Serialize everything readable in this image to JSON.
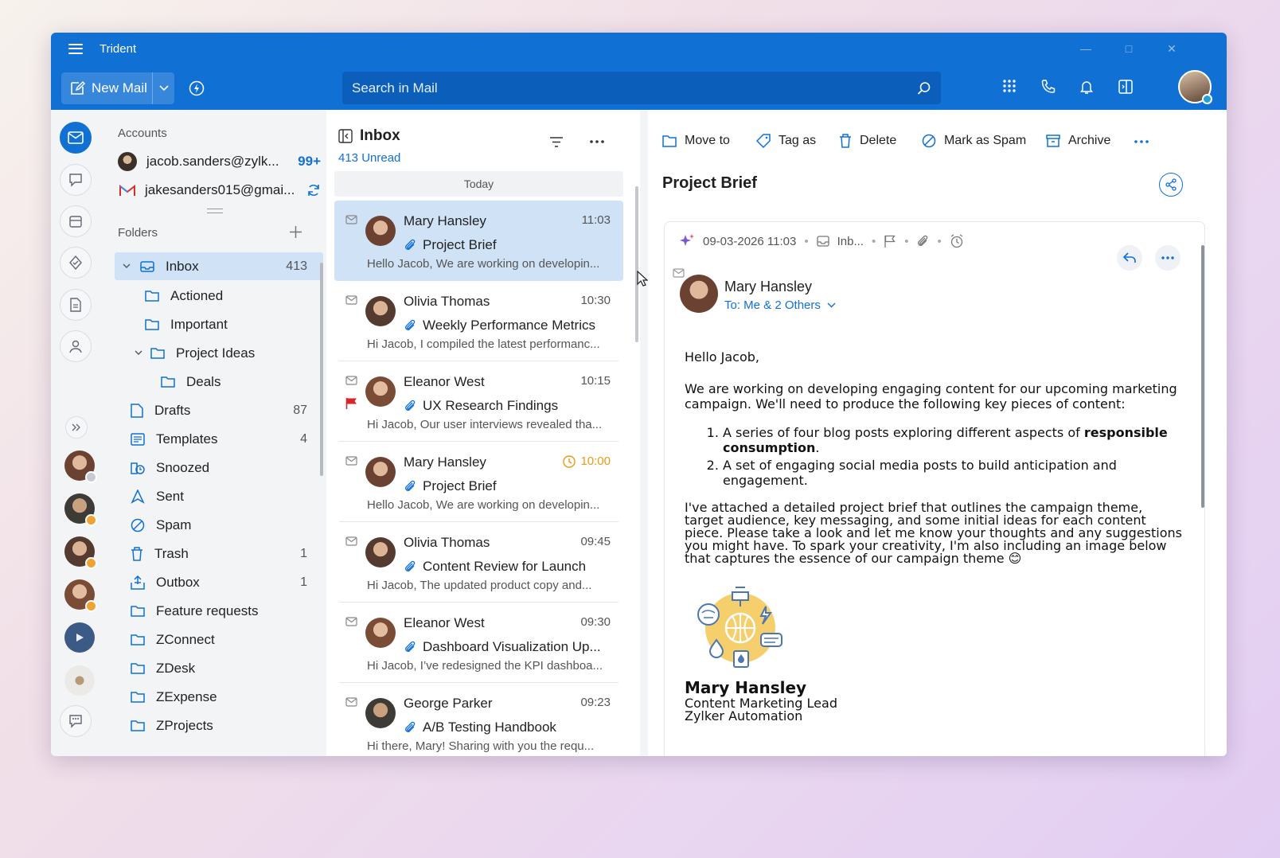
{
  "app": {
    "title": "Trident"
  },
  "toolbar": {
    "new_mail": "New Mail",
    "search_placeholder": "Search in Mail"
  },
  "accounts": {
    "label": "Accounts",
    "items": [
      {
        "email": "jacob.sanders@zylk...",
        "badge": "99+"
      },
      {
        "email": "jakesanders015@gmai..."
      }
    ]
  },
  "folders": {
    "label": "Folders",
    "items": [
      {
        "name": "Inbox",
        "count": "413"
      },
      {
        "name": "Actioned",
        "count": ""
      },
      {
        "name": "Important",
        "count": ""
      },
      {
        "name": "Project Ideas",
        "count": ""
      },
      {
        "name": "Deals",
        "count": ""
      },
      {
        "name": "Drafts",
        "count": "87"
      },
      {
        "name": "Templates",
        "count": "4"
      },
      {
        "name": "Snoozed",
        "count": ""
      },
      {
        "name": "Sent",
        "count": ""
      },
      {
        "name": "Spam",
        "count": ""
      },
      {
        "name": "Trash",
        "count": "1"
      },
      {
        "name": "Outbox",
        "count": "1"
      },
      {
        "name": "Feature requests",
        "count": ""
      },
      {
        "name": "ZConnect",
        "count": ""
      },
      {
        "name": "ZDesk",
        "count": ""
      },
      {
        "name": "ZExpense",
        "count": ""
      },
      {
        "name": "ZProjects",
        "count": ""
      }
    ]
  },
  "list": {
    "title": "Inbox",
    "unread": "413 Unread",
    "group": "Today",
    "mails": [
      {
        "from": "Mary Hansley",
        "time": "11:03",
        "subject": "Project Brief",
        "preview": "Hello Jacob, We are working on developin..."
      },
      {
        "from": "Olivia Thomas",
        "time": "10:30",
        "subject": "Weekly Performance Metrics",
        "preview": "Hi Jacob, I compiled the latest performanc..."
      },
      {
        "from": "Eleanor West",
        "time": "10:15",
        "subject": "UX Research Findings",
        "preview": "Hi Jacob, Our user interviews revealed tha..."
      },
      {
        "from": "Mary Hansley",
        "time": "10:00",
        "subject": "Project Brief",
        "preview": "Hello Jacob, We are working on developin..."
      },
      {
        "from": "Olivia Thomas",
        "time": "09:45",
        "subject": "Content Review for Launch",
        "preview": "Hi Jacob, The updated product copy and..."
      },
      {
        "from": "Eleanor West",
        "time": "09:30",
        "subject": "Dashboard Visualization Up...",
        "preview": "Hi Jacob, I’ve redesigned the KPI dashboa..."
      },
      {
        "from": "George Parker",
        "time": "09:23",
        "subject": "A/B Testing Handbook",
        "preview": "Hi there, Mary! Sharing with you the requ..."
      }
    ]
  },
  "reader": {
    "actions": {
      "move": "Move to",
      "tag": "Tag as",
      "delete": "Delete",
      "spam": "Mark as Spam",
      "archive": "Archive"
    },
    "subject": "Project Brief",
    "date": "09-03-2026 11:03",
    "folder": "Inb...",
    "sender": "Mary Hansley",
    "to": "To: Me & 2 Others",
    "greeting": "Hello Jacob,",
    "para1": "We are working on developing engaging content for our upcoming marketing campaign. We'll need to produce the following key pieces of content:",
    "li1_pre": "A series of four blog posts exploring different aspects of ",
    "li1_bold": "responsible consumption",
    "li1_post": ".",
    "li2": "A set of engaging social media posts to build anticipation and engagement.",
    "para2": "I've attached a detailed project brief that outlines the campaign theme, target audience, key messaging, and some initial ideas for each content piece. Please take a look and let me know your thoughts and any suggestions you might have. To spark your creativity, I'm also including an image below that captures the essence of our campaign theme 😊",
    "sig_name": "Mary Hansley",
    "sig_title": "Content Marketing Lead",
    "sig_company": "Zylker Automation"
  },
  "colors": {
    "brand": "#1070d4",
    "selected": "#cfe2f6",
    "accent_orange": "#e79b16",
    "flag_red": "#d7262a"
  }
}
